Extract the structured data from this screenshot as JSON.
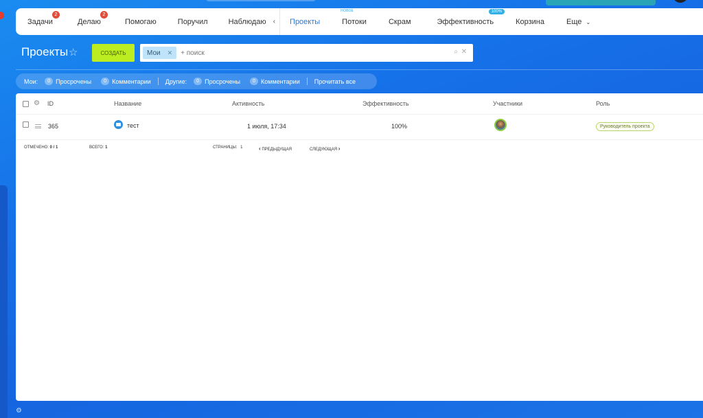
{
  "tabs": [
    {
      "label": "Задачи",
      "counter": "2"
    },
    {
      "label": "Делаю",
      "counter": "2"
    },
    {
      "label": "Помогаю"
    },
    {
      "label": "Поручил"
    },
    {
      "label": "Наблюдаю"
    }
  ],
  "tabs2": [
    {
      "label": "Проекты",
      "active": true
    },
    {
      "label": "Потоки",
      "note": "НОВОЕ"
    },
    {
      "label": "Скрам"
    },
    {
      "label": "Эффективность",
      "badge": "100%"
    },
    {
      "label": "Корзина"
    },
    {
      "label": "Еще"
    }
  ],
  "page": {
    "title": "Проекты",
    "create_label": "СОЗДАТЬ"
  },
  "search": {
    "chip": "Мои",
    "placeholder": "+ поиск"
  },
  "counters": {
    "mine_label": "Мои:",
    "others_label": "Другие:",
    "overdue": "Просрочены",
    "comments": "Комментарии",
    "mine_overdue": "0",
    "mine_comments": "0",
    "others_overdue": "0",
    "others_comments": "0",
    "read_all": "Прочитать все"
  },
  "grid": {
    "headers": {
      "id": "ID",
      "name": "Название",
      "activity": "Активность",
      "efficiency": "Эффективность",
      "members": "Участники",
      "role": "Роль"
    },
    "rows": [
      {
        "id": "365",
        "name": "тест",
        "activity": "1 июля, 17:34",
        "efficiency": "100%",
        "role": "Руководитель проекта"
      }
    ]
  },
  "footer": {
    "selected_label": "ОТМЕЧЕНО:",
    "selected_value": "0 / 1",
    "total_label": "ВСЕГО:",
    "total_value": "1",
    "pages_label": "СТРАНИЦЫ:",
    "pages_value": "1",
    "prev": "ПРЕДЫДУЩАЯ",
    "next": "СЛЕДУЮЩАЯ"
  },
  "colors": {
    "accent": "#2b78d6",
    "create_button": "#bbed21",
    "counter_red": "#e14d3a",
    "background": "#1670e8"
  }
}
